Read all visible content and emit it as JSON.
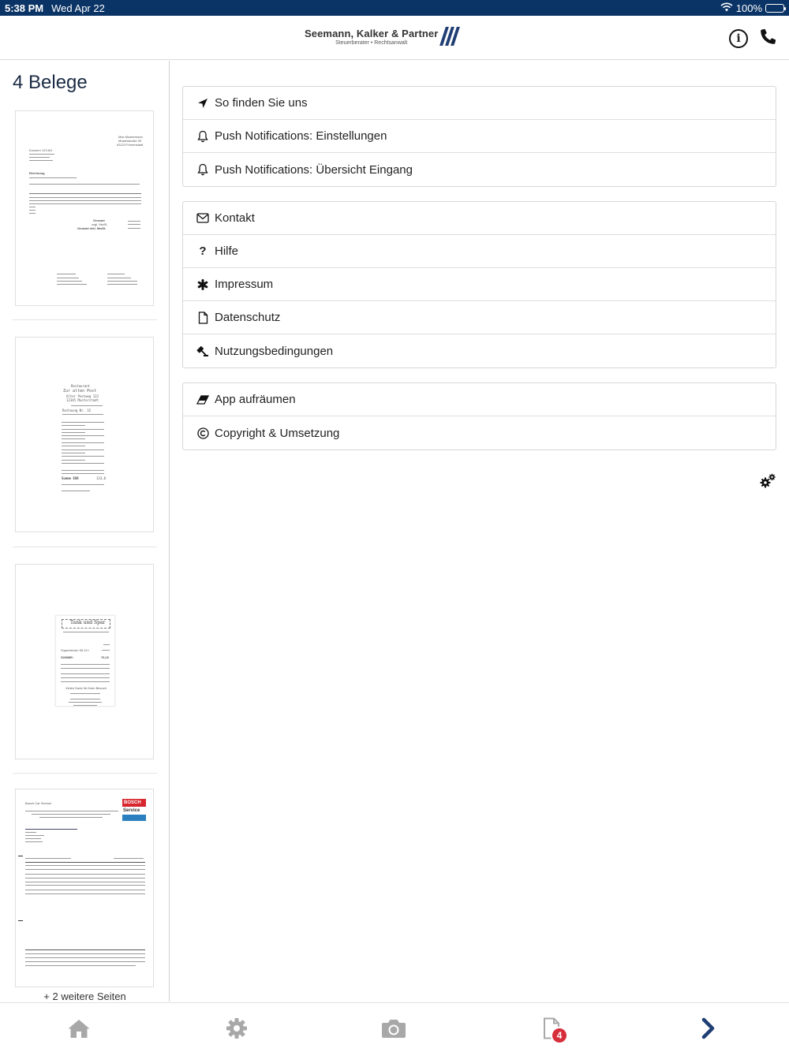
{
  "status_bar": {
    "time": "5:38 PM",
    "date": "Wed Apr 22",
    "battery": "100%"
  },
  "header": {
    "logo_name": "Seemann, Kalker & Partner",
    "logo_subtitle": "Steuerberater • Rechtsanwalt"
  },
  "sidebar": {
    "title": "4 Belege",
    "more_pages": "+ 2 weitere Seiten",
    "thumbnails": [
      {
        "label": "Rechnung Muster",
        "addr_name": "Max Mustermann",
        "addr_street": "Musterstraße 39",
        "addr_city": "63123 Firmenstadt",
        "company": "Konzern 123 AG",
        "heading": "Rechnung",
        "sum": "Gesamt",
        "vat": "zzgl. MwSt.",
        "total": "Gesamt inkl. MwSt."
      },
      {
        "label": "Restaurant Zur alten Post",
        "type": "Restaurant",
        "name": "Zur alten Post",
        "street": "Alter Postweg 123",
        "city": "12345 Musterstadt",
        "bill": "Rechnung Nr. 32",
        "total": "Summe EUR",
        "total_value": "133,0"
      },
      {
        "label": "Tank und Spar",
        "name": "Tank und Spar",
        "sum_label": "SUMME:",
        "sum_value": "76,16",
        "fuel": "Superbenzin 95-10 l",
        "thanks": "Vielen Dank für Ihren Besuch"
      },
      {
        "label": "Bosch Car Service",
        "company": "Bosch Car Service",
        "brand": "BOSCH",
        "brand_sub": "Service"
      }
    ]
  },
  "menu": {
    "group1": [
      {
        "label": "So finden Sie uns",
        "icon": "location-arrow-icon"
      },
      {
        "label": "Push Notifications: Einstellungen",
        "icon": "bell-icon"
      },
      {
        "label": "Push Notifications: Übersicht Eingang",
        "icon": "bell-icon"
      }
    ],
    "group2": [
      {
        "label": "Kontakt",
        "icon": "envelope-icon"
      },
      {
        "label": "Hilfe",
        "icon": "question-icon"
      },
      {
        "label": "Impressum",
        "icon": "asterisk-icon"
      },
      {
        "label": "Datenschutz",
        "icon": "file-icon"
      },
      {
        "label": "Nutzungsbedingungen",
        "icon": "gavel-icon"
      }
    ],
    "group3": [
      {
        "label": "App aufräumen",
        "icon": "eraser-icon"
      },
      {
        "label": "Copyright & Umsetzung",
        "icon": "copyright-icon"
      }
    ]
  },
  "tabbar": {
    "items": [
      "home-icon",
      "gear-icon",
      "camera-icon",
      "document-icon",
      "chevron-right-icon"
    ],
    "documents_badge": "4"
  },
  "colors": {
    "brand": "#1f3e74",
    "status_bar": "#0b3466",
    "badge": "#d62e3b",
    "tab_icon": "#a8a8a8",
    "active": "#1f3e74"
  }
}
